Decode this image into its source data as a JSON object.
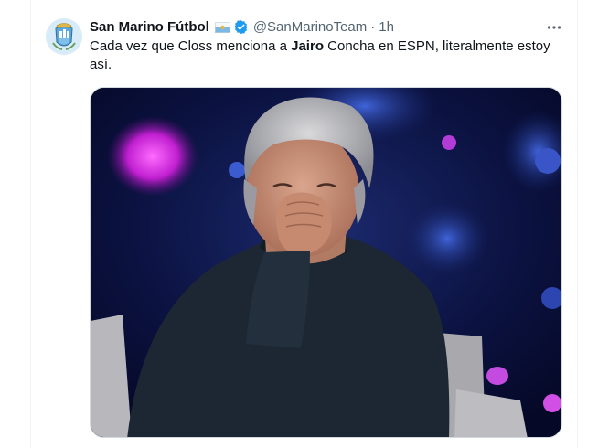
{
  "tweet": {
    "author_name": "San Marino Fútbol",
    "handle": "@SanMarinoTeam",
    "separator": "·",
    "time": "1h",
    "text_part1": "Cada vez que Closs menciona a ",
    "text_bold": "Jairo",
    "text_part2": " Concha en ESPN, literalmente estoy así."
  },
  "icons": {
    "avatar": "san-marino-crest",
    "flag": "san-marino-flag",
    "badge": "verified-badge",
    "more": "more-dots"
  },
  "colors": {
    "verified": "#1d9bf0",
    "secondary_text": "#536471",
    "primary_text": "#0f1419"
  }
}
